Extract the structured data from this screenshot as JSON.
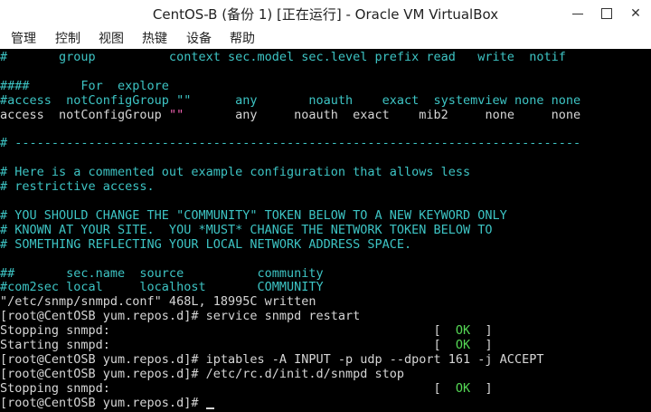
{
  "window": {
    "title": "CentOS-B (备份 1) [正在运行] - Oracle VM VirtualBox",
    "minimize_glyph": "",
    "maximize_glyph": "",
    "close_glyph": "✕"
  },
  "menu": [
    "管理",
    "控制",
    "视图",
    "热键",
    "设备",
    "帮助"
  ],
  "terminal": {
    "lines": [
      {
        "text": "#       group          context sec.model sec.level prefix read   write  notif",
        "color": "cyan"
      },
      {
        "text": "",
        "color": "cyan"
      },
      {
        "text": "####       For  explore",
        "color": "cyan"
      },
      {
        "text": "#access  notConfigGroup \"\"      any       noauth    exact  systemview none none",
        "color": "cyan"
      },
      {
        "text": "access  notConfigGroup ",
        "color": "white",
        "extra": "\"\"",
        "extra_color": "pink",
        "rest": "       any     noauth  exact    mib2     none     none"
      },
      {
        "text": "",
        "color": "cyan"
      },
      {
        "text": "# -----------------------------------------------------------------------------",
        "color": "cyan"
      },
      {
        "text": "",
        "color": "cyan"
      },
      {
        "text": "# Here is a commented out example configuration that allows less",
        "color": "cyan"
      },
      {
        "text": "# restrictive access.",
        "color": "cyan"
      },
      {
        "text": "",
        "color": "cyan"
      },
      {
        "text": "# YOU SHOULD CHANGE THE \"COMMUNITY\" TOKEN BELOW TO A NEW KEYWORD ONLY",
        "color": "cyan"
      },
      {
        "text": "# KNOWN AT YOUR SITE.  YOU *MUST* CHANGE THE NETWORK TOKEN BELOW TO",
        "color": "cyan"
      },
      {
        "text": "# SOMETHING REFLECTING YOUR LOCAL NETWORK ADDRESS SPACE.",
        "color": "cyan"
      },
      {
        "text": "",
        "color": "cyan"
      },
      {
        "text": "##       sec.name  source          community",
        "color": "cyan"
      },
      {
        "text": "#com2sec local     localhost       COMMUNITY",
        "color": "cyan"
      },
      {
        "text": "\"/etc/snmp/snmpd.conf\" 468L, 18995C written",
        "color": "white"
      },
      {
        "text": "[root@CentOSB yum.repos.d]# service snmpd restart",
        "color": "white"
      },
      {
        "text": "Stopping snmpd:                                            [  ",
        "color": "white",
        "status": "OK",
        "tail": "  ]"
      },
      {
        "text": "Starting snmpd:                                            [  ",
        "color": "white",
        "status": "OK",
        "tail": "  ]"
      },
      {
        "text": "[root@CentOSB yum.repos.d]# iptables -A INPUT -p udp --dport 161 -j ACCEPT",
        "color": "white"
      },
      {
        "text": "[root@CentOSB yum.repos.d]# /etc/rc.d/init.d/snmpd stop",
        "color": "white"
      },
      {
        "text": "Stopping snmpd:                                            [  ",
        "color": "white",
        "status": "OK",
        "tail": "  ]"
      },
      {
        "text": "[root@CentOSB yum.repos.d]# ",
        "color": "white",
        "cursor": true
      }
    ]
  },
  "colors": {
    "comment": "#3dc4c4",
    "text": "#d6d6d6",
    "ok": "#55d855",
    "string": "#f060b0",
    "background": "#000000"
  }
}
